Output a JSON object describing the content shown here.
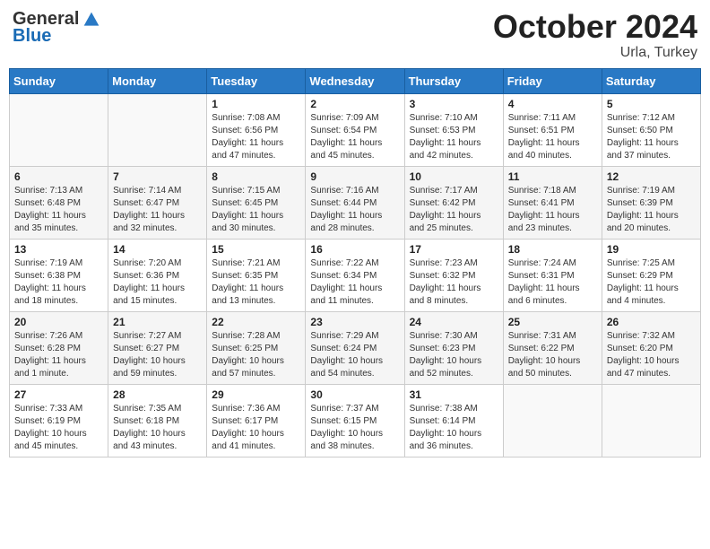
{
  "logo": {
    "general": "General",
    "blue": "Blue"
  },
  "title": "October 2024",
  "location": "Urla, Turkey",
  "days_of_week": [
    "Sunday",
    "Monday",
    "Tuesday",
    "Wednesday",
    "Thursday",
    "Friday",
    "Saturday"
  ],
  "weeks": [
    [
      {
        "day": "",
        "info": ""
      },
      {
        "day": "",
        "info": ""
      },
      {
        "day": "1",
        "info": "Sunrise: 7:08 AM\nSunset: 6:56 PM\nDaylight: 11 hours and 47 minutes."
      },
      {
        "day": "2",
        "info": "Sunrise: 7:09 AM\nSunset: 6:54 PM\nDaylight: 11 hours and 45 minutes."
      },
      {
        "day": "3",
        "info": "Sunrise: 7:10 AM\nSunset: 6:53 PM\nDaylight: 11 hours and 42 minutes."
      },
      {
        "day": "4",
        "info": "Sunrise: 7:11 AM\nSunset: 6:51 PM\nDaylight: 11 hours and 40 minutes."
      },
      {
        "day": "5",
        "info": "Sunrise: 7:12 AM\nSunset: 6:50 PM\nDaylight: 11 hours and 37 minutes."
      }
    ],
    [
      {
        "day": "6",
        "info": "Sunrise: 7:13 AM\nSunset: 6:48 PM\nDaylight: 11 hours and 35 minutes."
      },
      {
        "day": "7",
        "info": "Sunrise: 7:14 AM\nSunset: 6:47 PM\nDaylight: 11 hours and 32 minutes."
      },
      {
        "day": "8",
        "info": "Sunrise: 7:15 AM\nSunset: 6:45 PM\nDaylight: 11 hours and 30 minutes."
      },
      {
        "day": "9",
        "info": "Sunrise: 7:16 AM\nSunset: 6:44 PM\nDaylight: 11 hours and 28 minutes."
      },
      {
        "day": "10",
        "info": "Sunrise: 7:17 AM\nSunset: 6:42 PM\nDaylight: 11 hours and 25 minutes."
      },
      {
        "day": "11",
        "info": "Sunrise: 7:18 AM\nSunset: 6:41 PM\nDaylight: 11 hours and 23 minutes."
      },
      {
        "day": "12",
        "info": "Sunrise: 7:19 AM\nSunset: 6:39 PM\nDaylight: 11 hours and 20 minutes."
      }
    ],
    [
      {
        "day": "13",
        "info": "Sunrise: 7:19 AM\nSunset: 6:38 PM\nDaylight: 11 hours and 18 minutes."
      },
      {
        "day": "14",
        "info": "Sunrise: 7:20 AM\nSunset: 6:36 PM\nDaylight: 11 hours and 15 minutes."
      },
      {
        "day": "15",
        "info": "Sunrise: 7:21 AM\nSunset: 6:35 PM\nDaylight: 11 hours and 13 minutes."
      },
      {
        "day": "16",
        "info": "Sunrise: 7:22 AM\nSunset: 6:34 PM\nDaylight: 11 hours and 11 minutes."
      },
      {
        "day": "17",
        "info": "Sunrise: 7:23 AM\nSunset: 6:32 PM\nDaylight: 11 hours and 8 minutes."
      },
      {
        "day": "18",
        "info": "Sunrise: 7:24 AM\nSunset: 6:31 PM\nDaylight: 11 hours and 6 minutes."
      },
      {
        "day": "19",
        "info": "Sunrise: 7:25 AM\nSunset: 6:29 PM\nDaylight: 11 hours and 4 minutes."
      }
    ],
    [
      {
        "day": "20",
        "info": "Sunrise: 7:26 AM\nSunset: 6:28 PM\nDaylight: 11 hours and 1 minute."
      },
      {
        "day": "21",
        "info": "Sunrise: 7:27 AM\nSunset: 6:27 PM\nDaylight: 10 hours and 59 minutes."
      },
      {
        "day": "22",
        "info": "Sunrise: 7:28 AM\nSunset: 6:25 PM\nDaylight: 10 hours and 57 minutes."
      },
      {
        "day": "23",
        "info": "Sunrise: 7:29 AM\nSunset: 6:24 PM\nDaylight: 10 hours and 54 minutes."
      },
      {
        "day": "24",
        "info": "Sunrise: 7:30 AM\nSunset: 6:23 PM\nDaylight: 10 hours and 52 minutes."
      },
      {
        "day": "25",
        "info": "Sunrise: 7:31 AM\nSunset: 6:22 PM\nDaylight: 10 hours and 50 minutes."
      },
      {
        "day": "26",
        "info": "Sunrise: 7:32 AM\nSunset: 6:20 PM\nDaylight: 10 hours and 47 minutes."
      }
    ],
    [
      {
        "day": "27",
        "info": "Sunrise: 7:33 AM\nSunset: 6:19 PM\nDaylight: 10 hours and 45 minutes."
      },
      {
        "day": "28",
        "info": "Sunrise: 7:35 AM\nSunset: 6:18 PM\nDaylight: 10 hours and 43 minutes."
      },
      {
        "day": "29",
        "info": "Sunrise: 7:36 AM\nSunset: 6:17 PM\nDaylight: 10 hours and 41 minutes."
      },
      {
        "day": "30",
        "info": "Sunrise: 7:37 AM\nSunset: 6:15 PM\nDaylight: 10 hours and 38 minutes."
      },
      {
        "day": "31",
        "info": "Sunrise: 7:38 AM\nSunset: 6:14 PM\nDaylight: 10 hours and 36 minutes."
      },
      {
        "day": "",
        "info": ""
      },
      {
        "day": "",
        "info": ""
      }
    ]
  ]
}
